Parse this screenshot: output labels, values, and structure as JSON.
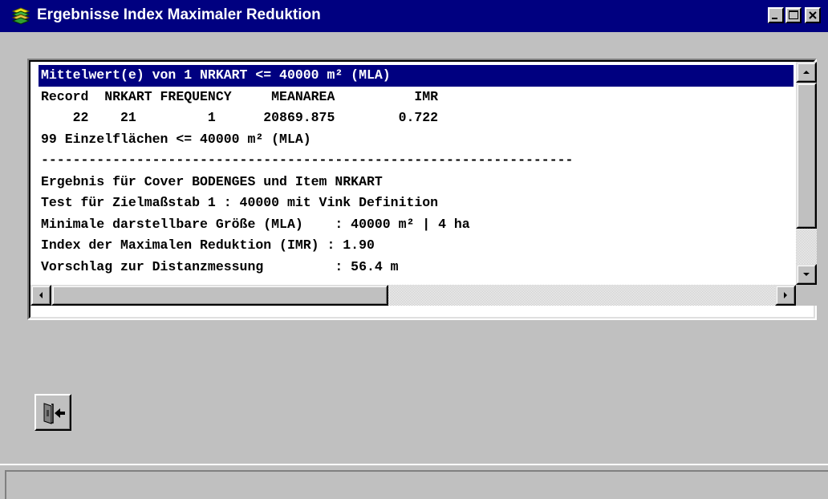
{
  "window": {
    "title": "Ergebnisse Index Maximaler Reduktion",
    "icon": "stacked-layers-icon",
    "controls": [
      "minimize-icon",
      "maximize-icon",
      "close-icon"
    ]
  },
  "results": {
    "lines": [
      "Mittelwert(e) von 1 NRKART <= 40000 m² (MLA)",
      "Record  NRKART FREQUENCY     MEANAREA          IMR",
      "    22    21         1      20869.875        0.722",
      "99 Einzelflächen <= 40000 m² (MLA)",
      "-------------------------------------------------------------------",
      "Ergebnis für Cover BODENGES und Item NRKART",
      "Test für Zielmaßstab 1 : 40000 mit Vink Definition",
      "Minimale darstellbare Größe (MLA)    : 40000 m² | 4 ha",
      "Index der Maximalen Reduktion (IMR) : 1.90",
      "Vorschlag zur Distanzmessung         : 56.4 m"
    ],
    "selected_index": 0
  },
  "exit_button": {
    "icon": "exit-door-icon"
  },
  "statusbar": {
    "text": ""
  },
  "colors": {
    "titlebar": "#000080",
    "face": "#c0c0c0",
    "selection": "#000080"
  }
}
